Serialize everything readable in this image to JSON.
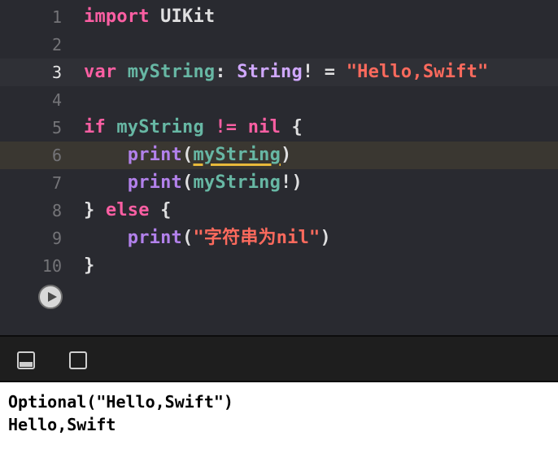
{
  "editor": {
    "lines": [
      {
        "num": "1"
      },
      {
        "num": "2"
      },
      {
        "num": "3"
      },
      {
        "num": "4"
      },
      {
        "num": "5"
      },
      {
        "num": "6"
      },
      {
        "num": "7"
      },
      {
        "num": "8"
      },
      {
        "num": "9"
      },
      {
        "num": "10"
      }
    ],
    "tokens": {
      "l1_import": "import",
      "l1_module": " UIKit",
      "l3_var": "var",
      "l3_name": " myString",
      "l3_colon": ": ",
      "l3_type": "String",
      "l3_op": "! = ",
      "l3_str": "\"Hello,Swift\"",
      "l5_if": "if",
      "l5_name": " myString",
      "l5_op": " != ",
      "l5_nil": "nil",
      "l5_brace": " {",
      "l6_indent": "    ",
      "l6_fn": "print",
      "l6_open": "(",
      "l6_arg": "myString",
      "l6_close": ")",
      "l7_indent": "    ",
      "l7_fn": "print",
      "l7_open": "(",
      "l7_arg": "myString",
      "l7_close": "!)",
      "l8_close": "} ",
      "l8_else": "else",
      "l8_brace": " {",
      "l9_indent": "    ",
      "l9_fn": "print",
      "l9_open": "(",
      "l9_str": "\"字符串为nil\"",
      "l9_close": ")",
      "l10_close": "}"
    }
  },
  "console": {
    "lines": [
      "Optional(\"Hello,Swift\")",
      "Hello,Swift"
    ]
  },
  "colors": {
    "background": "#292a30",
    "keyword": "#fc5fa3",
    "type": "#d0a8ff",
    "identifier": "#67b7a4",
    "function": "#b281eb",
    "string": "#fc6a5d",
    "warning_highlight": "#3a3731",
    "current_line": "#2f3036"
  },
  "icons": {
    "run": "play-icon",
    "hide_console": "console-panel-icon",
    "show_console": "square-icon"
  }
}
